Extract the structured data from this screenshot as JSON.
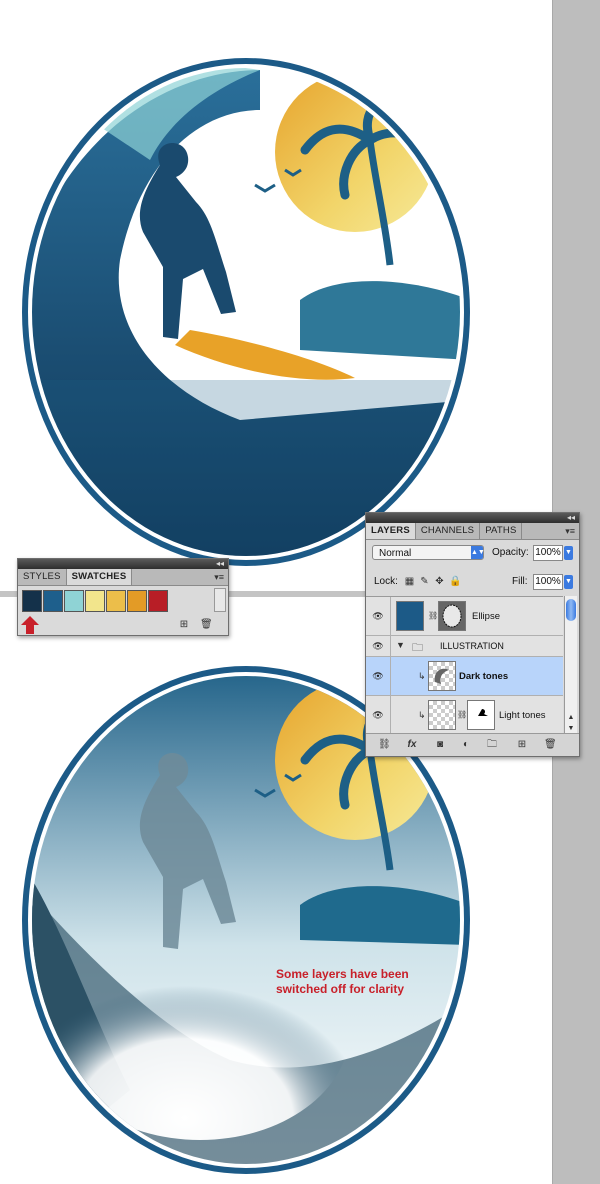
{
  "annotation": {
    "line1": "Some layers have been",
    "line2": "switched off for clarity"
  },
  "swatches_panel": {
    "tabs": [
      {
        "label": "STYLES",
        "active": false
      },
      {
        "label": "SWATCHES",
        "active": true
      }
    ],
    "colors": [
      "#14314a",
      "#1e5f8c",
      "#8fd3d5",
      "#f2e58c",
      "#ecbe4a",
      "#e39b26",
      "#b81e26"
    ]
  },
  "layers_panel": {
    "tabs": [
      {
        "label": "LAYERS",
        "active": true
      },
      {
        "label": "CHANNELS",
        "active": false
      },
      {
        "label": "PATHS",
        "active": false
      }
    ],
    "blend_mode": "Normal",
    "opacity_label": "Opacity:",
    "opacity_value": "100%",
    "lock_label": "Lock:",
    "fill_label": "Fill:",
    "fill_value": "100%",
    "layers": [
      {
        "name": "Ellipse",
        "selected": false
      },
      {
        "name": "ILLUSTRATION",
        "selected": false,
        "group": true
      },
      {
        "name": "Dark tones",
        "selected": true
      },
      {
        "name": "Light tones",
        "selected": false
      }
    ]
  },
  "colors": {
    "accent_blue": "#1c5a87",
    "annotation_red": "#c8202a",
    "selection": "#b8d4fa"
  }
}
